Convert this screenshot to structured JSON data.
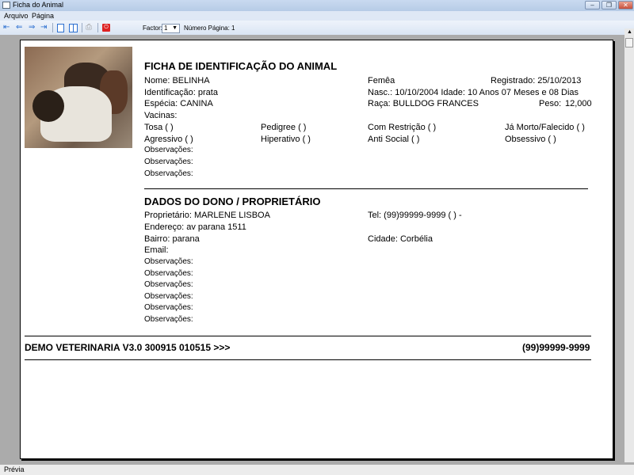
{
  "window": {
    "title": "Ficha do Animal"
  },
  "menu": [
    "Arquivo",
    "Página"
  ],
  "toolbar": {
    "factor_label": "Factor:",
    "factor_value": "1",
    "page_label": "Número Página: 1"
  },
  "status": "Prévia",
  "animal": {
    "heading": "FICHA DE IDENTIFICAÇÃO DO ANIMAL",
    "nome": "Nome: BELINHA",
    "sexo": "Femêa",
    "registrado": "Registrado: 25/10/2013",
    "identificacao": "Identificação: prata",
    "nasc": "Nasc.: 10/10/2004 Idade: 10 Anos 07 Meses e 08 Dias",
    "especie": "Espécia: CANINA",
    "raca": "Raça: BULLDOG FRANCES",
    "peso_label": "Peso:",
    "peso": "12,000",
    "vacinas": "Vacinas:",
    "flags": [
      "Tosa  (  )",
      "Pedigree  (  )",
      "Com Restrição (  )",
      "Já Morto/Falecido (  )",
      "Agressivo  (  )",
      "Hiperativo  (  )",
      "Anti Social (  )",
      "Obsessivo (  )"
    ],
    "obs": [
      "Observações:",
      "Observações:",
      "Observações:"
    ]
  },
  "owner": {
    "heading": "DADOS DO DONO / PROPRIETÁRIO",
    "proprietario": "Proprietário: MARLENE LISBOA",
    "tel": "Tel: (99)99999-9999 (  )     -",
    "endereco": "Endereço: av parana 1511",
    "bairro": "Bairro: parana",
    "cidade": "Cidade: Corbélia",
    "email": "Email:",
    "obs": [
      "Observações:",
      "Observações:",
      "Observações:",
      "Observações:",
      "Observações:",
      "Observações:"
    ]
  },
  "footer": {
    "left": "DEMO VETERINARIA V3.0 300915 010515 >>>",
    "right": "(99)99999-9999"
  }
}
